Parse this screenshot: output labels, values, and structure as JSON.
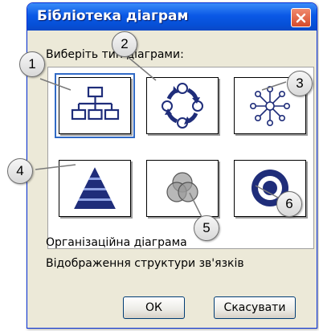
{
  "window": {
    "title": "Бібліотека діаграм",
    "close_icon": "close-icon"
  },
  "prompt": {
    "before_underline": "Виберіть т",
    "underlined": "",
    "after": "ип діаграми:"
  },
  "prompt_full": "Виберіть тип діаграми:",
  "diagram_types": [
    {
      "icon": "org-chart-icon",
      "selected": true
    },
    {
      "icon": "cycle-diagram-icon",
      "selected": false
    },
    {
      "icon": "radial-diagram-icon",
      "selected": false
    },
    {
      "icon": "pyramid-diagram-icon",
      "selected": false
    },
    {
      "icon": "venn-diagram-icon",
      "selected": false
    },
    {
      "icon": "target-diagram-icon",
      "selected": false
    }
  ],
  "description": {
    "name": "Організаційна діаграма",
    "text": "Відображення структури зв'язків"
  },
  "buttons": {
    "ok": "ОК",
    "cancel": "Скасувати"
  },
  "callouts": [
    "1",
    "2",
    "3",
    "4",
    "5",
    "6"
  ],
  "colors": {
    "titlebar": "#0a58e6",
    "dialog_bg": "#ece9d8",
    "close_button": "#d64b2b",
    "icon_blue": "#1f2d7a",
    "selection": "#316ac5"
  }
}
